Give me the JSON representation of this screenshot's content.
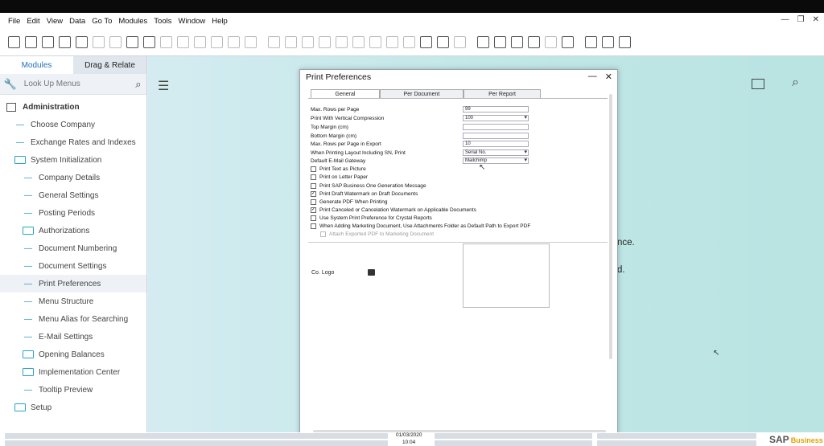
{
  "menubar": {
    "items": [
      "File",
      "Edit",
      "View",
      "Data",
      "Go To",
      "Modules",
      "Tools",
      "Window",
      "Help"
    ]
  },
  "window_controls": [
    "—",
    "❐",
    "✕"
  ],
  "left_panel": {
    "tabs": [
      "Modules",
      "Drag & Relate"
    ],
    "search_placeholder": "Look Up Menus",
    "tree": [
      {
        "label": "Administration",
        "kind": "head"
      },
      {
        "label": "Choose Company",
        "kind": "l1-dash"
      },
      {
        "label": "Exchange Rates and Indexes",
        "kind": "l1-dash"
      },
      {
        "label": "System Initialization",
        "kind": "l1-folder"
      },
      {
        "label": "Company Details",
        "kind": "l2-dash"
      },
      {
        "label": "General Settings",
        "kind": "l2-dash"
      },
      {
        "label": "Posting Periods",
        "kind": "l2-dash"
      },
      {
        "label": "Authorizations",
        "kind": "l2-folder"
      },
      {
        "label": "Document Numbering",
        "kind": "l2-dash"
      },
      {
        "label": "Document Settings",
        "kind": "l2-dash"
      },
      {
        "label": "Print Preferences",
        "kind": "l2-dash",
        "selected": true
      },
      {
        "label": "Menu Structure",
        "kind": "l2-dash"
      },
      {
        "label": "Menu Alias for Searching",
        "kind": "l2-dash"
      },
      {
        "label": "E-Mail Settings",
        "kind": "l2-dash"
      },
      {
        "label": "Opening Balances",
        "kind": "l2-folder"
      },
      {
        "label": "Implementation Center",
        "kind": "l2-folder"
      },
      {
        "label": "Tooltip Preview",
        "kind": "l2-dash"
      },
      {
        "label": "Setup",
        "kind": "l1-folder"
      }
    ]
  },
  "background_text": {
    "line1": "nce.",
    "line2": "d."
  },
  "dialog": {
    "title": "Print Preferences",
    "tabs": [
      "General",
      "Per Document",
      "Per Report"
    ],
    "fields": [
      {
        "label": "Max. Rows per Page",
        "value": "99",
        "dropdown": false
      },
      {
        "label": "Print With Vertical Compression",
        "value": "100",
        "dropdown": true
      },
      {
        "label": "Top Margin (cm)",
        "value": "",
        "dropdown": false
      },
      {
        "label": "Bottom Margin (cm)",
        "value": "",
        "dropdown": false
      },
      {
        "label": "Max. Rows per Page in Export",
        "value": "10",
        "dropdown": false
      },
      {
        "label": "When Printing Layout Including SN, Print",
        "value": "Serial No.",
        "dropdown": true
      },
      {
        "label": "Default E-Mail Gateway",
        "value": "Mailchimp",
        "dropdown": true
      }
    ],
    "checkboxes": [
      {
        "label": "Print Text as Picture",
        "checked": false
      },
      {
        "label": "Print on Letter Paper",
        "checked": false
      },
      {
        "label": "Print SAP Business One Generation Message",
        "checked": false
      },
      {
        "label": "Print Draft Watermark on Draft Documents",
        "checked": true
      },
      {
        "label": "Generate PDF When Printing",
        "checked": false
      },
      {
        "label": "Print Canceled or Cancelation Watermark on Applicable Documents",
        "checked": true
      },
      {
        "label": "Use System Print Preference for Crystal Reports",
        "checked": false
      },
      {
        "label": "When Adding Marketing Document, Use Attachments Folder as Default Path to Export PDF",
        "checked": false
      },
      {
        "label": "Attach Exported PDF to Marketing Document",
        "checked": false,
        "disabled": true
      }
    ],
    "logo_label": "Co. Logo"
  },
  "statusbar": {
    "date": "01/03/2020",
    "time": "10:04",
    "brand": "SAP",
    "brand_suffix": "Business One"
  }
}
